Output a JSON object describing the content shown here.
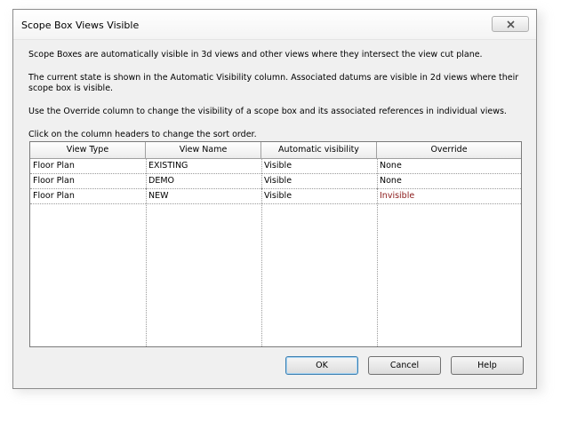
{
  "window": {
    "title": "Scope Box Views Visible"
  },
  "description": {
    "line1": "Scope Boxes are automatically visible in 3d views and other views where they intersect the view cut plane.",
    "line2": "The current state is shown in the Automatic Visibility column. Associated datums are visible in 2d views where their scope box is visible.",
    "line3": "Use the Override column to change the visibility of a scope box and its associated references in individual views.",
    "line4": "Click on the column headers to change the sort order."
  },
  "table": {
    "columns": [
      "View Type",
      "View Name",
      "Automatic visibility",
      "Override"
    ],
    "rows": [
      {
        "view_type": "Floor Plan",
        "view_name": "EXISTING",
        "automatic": "Visible",
        "override": "None"
      },
      {
        "view_type": "Floor Plan",
        "view_name": "DEMO",
        "automatic": "Visible",
        "override": "None"
      },
      {
        "view_type": "Floor Plan",
        "view_name": "NEW",
        "automatic": "Visible",
        "override": "Invisible"
      }
    ]
  },
  "buttons": {
    "ok": "OK",
    "cancel": "Cancel",
    "help": "Help"
  },
  "colors": {
    "override_changed": "#8b1a1a"
  }
}
